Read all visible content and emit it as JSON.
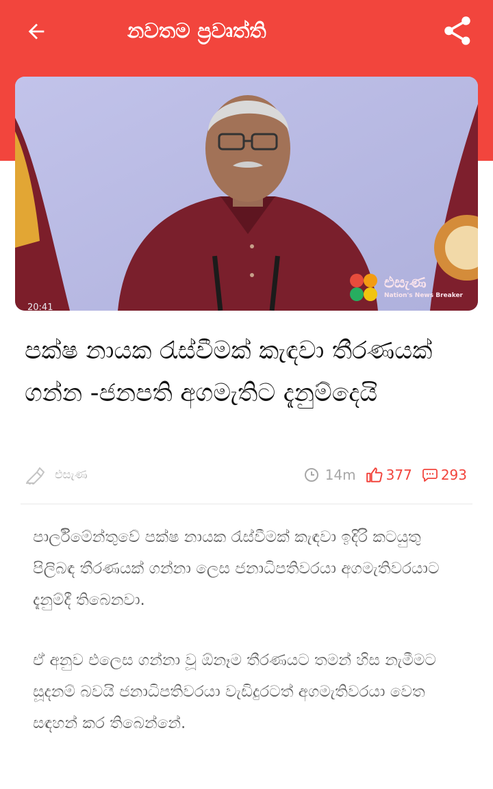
{
  "header": {
    "title": "නවතම ප්‍රවෘත්ති",
    "back_icon": "arrow-left-icon",
    "share_icon": "share-icon",
    "color": "#f2453d"
  },
  "hero": {
    "watermark_text": "එසැණ",
    "watermark_sub": "Nation's News Breaker",
    "timestamp": "20:41"
  },
  "article": {
    "headline": "පක්ෂ නායක රැස්වීමක් කැඳවා තීරණයක් ගන්න  -ජනපති අගමැතිට දැනුම්දෙයි",
    "author": "එසැණ",
    "time_ago": "14m",
    "likes": "377",
    "comments": "293",
    "paragraphs": [
      "පාර්ලිමේන්තුවේ පක්ෂ නායක රැස්වීමක් කැඳවා ඉදිරි කටයුතු පිලිබඳ තීරණයක් ගන්නා ලෙස ජනාධිපතිවරයා අගමැතිවරයාට දැනුම්දී තිබෙනවා.",
      "ඒ අනුව එලෙස ගන්නා වූ ඕනෑම තීරණයට තමන් හිස නැමීමට සූදනම් බවයි ජනාධිපතිවරයා වැඩිදුරටත් අගමැතිවරයා වෙත සඳහන් කර තිබෙන්නේ."
    ]
  }
}
